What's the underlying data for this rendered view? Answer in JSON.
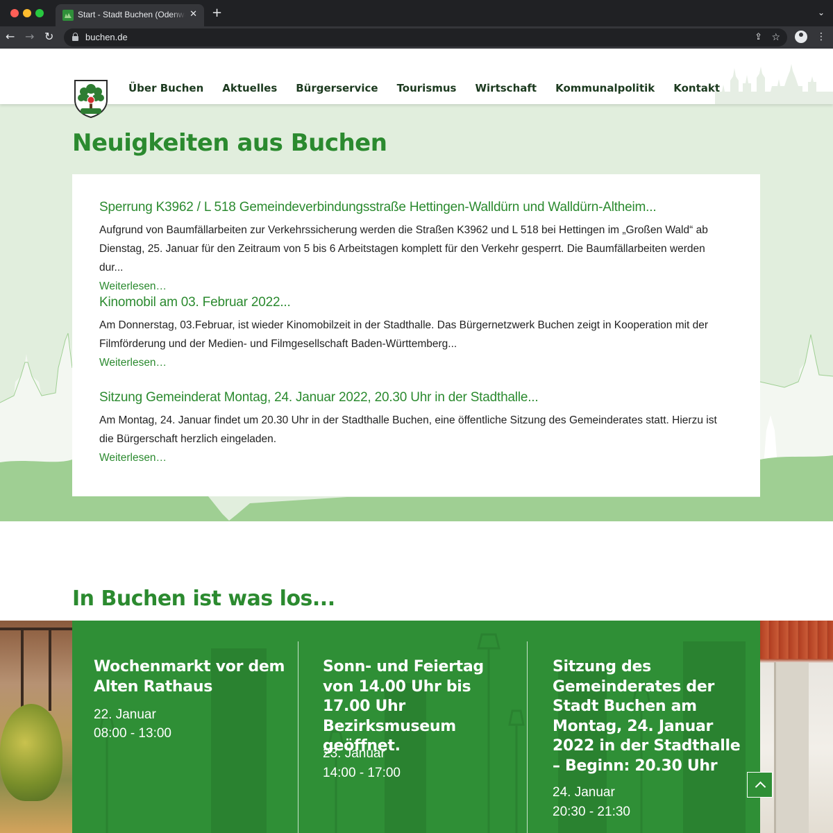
{
  "browser": {
    "tab_title": "Start - Stadt Buchen (Odenwald)",
    "tab_close_glyph": "✕",
    "new_tab_glyph": "+",
    "tab_menu_glyph": "⌄",
    "back_glyph": "←",
    "forward_glyph": "→",
    "reload_glyph": "↻",
    "url": "buchen.de",
    "share_glyph": "⇪",
    "star_glyph": "☆",
    "kebab_glyph": "⋮"
  },
  "nav": {
    "items": [
      "Über Buchen",
      "Aktuelles",
      "Bürgerservice",
      "Tourismus",
      "Wirtschaft",
      "Kommunalpolitik",
      "Kontakt"
    ]
  },
  "news": {
    "heading": "Neuigkeiten aus Buchen",
    "items": [
      {
        "title": "Sperrung K3962 / L 518 Gemeindeverbindungsstraße Hettingen-Walldürn und Walldürn-Altheim...",
        "text": "Aufgrund von Baumfällarbeiten zur Verkehrssicherung werden die Straßen K3962 und L 518 bei Hettingen im „Großen Wald“ ab Dienstag, 25. Januar für den Zeitraum von 5 bis 6 Arbeitstagen komplett für den Verkehr gesperrt. Die Baumfällarbeiten werden dur...",
        "more": "Weiterlesen…"
      },
      {
        "title": "Kinomobil am 03. Februar 2022...",
        "text": "Am Donnerstag, 03.Februar, ist wieder Kinomobilzeit in der Stadthalle. Das Bürgernetzwerk Buchen zeigt in Kooperation mit der Filmförderung und der Medien- und Filmgesellschaft Baden-Württemberg...",
        "more": "Weiterlesen…"
      },
      {
        "title": "Sitzung Gemeinderat Montag, 24. Januar 2022, 20.30 Uhr in der Stadthalle...",
        "text": "Am Montag, 24. Januar findet um 20.30 Uhr in der Stadthalle Buchen, eine öffentliche Sitzung des Gemeinderates statt. Hierzu ist die Bürgerschaft herzlich eingeladen.",
        "more": "Weiterlesen…"
      }
    ]
  },
  "events": {
    "heading": "In Buchen ist was los...",
    "items": [
      {
        "title": "Wochenmarkt vor dem Alten Rathaus",
        "date": "22. Januar",
        "time": "08:00 - 13:00"
      },
      {
        "title": "Sonn- und Feiertag von 14.00 Uhr bis 17.00 Uhr Bezirksmuseum geöffnet.",
        "date": "23. Januar",
        "time": "14:00 - 17:00"
      },
      {
        "title": "Sitzung des Gemeinderates der Stadt Buchen am Montag, 24. Januar 2022 in der Stadthalle – Beginn: 20.30 Uhr",
        "date": "24. Januar",
        "time": "20:30 - 21:30"
      }
    ]
  },
  "colors": {
    "brand_green": "#2b8a2f",
    "event_green": "#2f8f36",
    "light_green_bg": "#e1eedd",
    "hill_green": "#9fcf93",
    "nav_text": "#1c3a1f"
  },
  "icons": {
    "logo": "coat-of-arms-icon",
    "scroll_top": "chevron-up-icon"
  }
}
